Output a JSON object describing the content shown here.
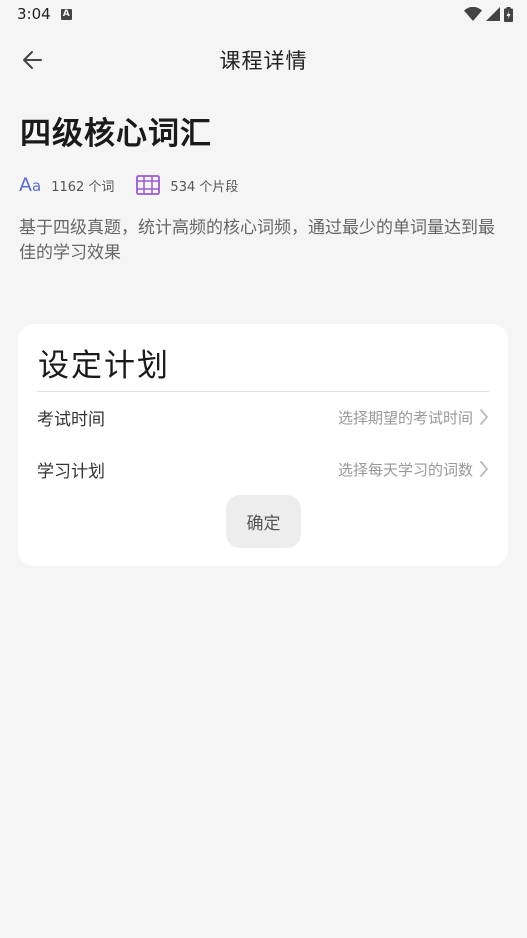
{
  "status_bar": {
    "time": "3:04",
    "notification_glyph": "A"
  },
  "app_bar": {
    "title": "课程详情"
  },
  "course": {
    "title": "四级核心词汇",
    "word_count": "1162 个词",
    "clip_count": "534 个片段",
    "description": "基于四级真题，统计高频的核心词频，通过最少的单词量达到最佳的学习效果"
  },
  "plan": {
    "title": "设定计划",
    "exam_time_label": "考试时间",
    "exam_time_placeholder": "选择期望的考试时间",
    "study_plan_label": "学习计划",
    "study_plan_placeholder": "选择每天学习的词数",
    "confirm_label": "确定"
  },
  "colors": {
    "accent_icon_blue": "#5b6bd6",
    "accent_icon_purple": "#9b59d6",
    "background": "#f5f5f5",
    "card": "#ffffff"
  },
  "icons": {
    "back": "arrow-left-icon",
    "words": "font-aa-icon",
    "clips": "film-icon",
    "chevron": "chevron-right-icon"
  }
}
